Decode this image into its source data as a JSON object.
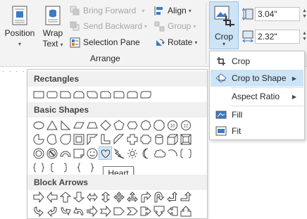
{
  "ribbon": {
    "position_label": "Position",
    "wrap_text_label_1": "Wrap",
    "wrap_text_label_2": "Text",
    "bring_forward_label": "Bring Forward",
    "send_backward_label": "Send Backward",
    "selection_pane_label": "Selection Pane",
    "align_label": "Align",
    "group_label": "Group",
    "rotate_label": "Rotate",
    "arrange_group_label": "Arrange",
    "crop_label": "Crop",
    "height_value": "3.04\"",
    "width_value": "2.32\""
  },
  "crop_menu": {
    "items": [
      {
        "label": "Crop",
        "icon": "crop-icon"
      },
      {
        "label": "Crop to Shape",
        "icon": "crop-to-shape-icon"
      },
      {
        "label": "Aspect Ratio",
        "icon": ""
      },
      {
        "label": "Fill",
        "icon": "fill-icon"
      },
      {
        "label": "Fit",
        "icon": "fit-icon"
      }
    ]
  },
  "shapes_panel": {
    "categories": [
      "Rectangles",
      "Basic Shapes",
      "Block Arrows"
    ],
    "tooltip": "Heart"
  },
  "colors": {
    "highlight": "#cde4f7",
    "highlight_border": "#9cc6e8",
    "ribbon_bg": "#f3f3f3",
    "header_bg": "#f0f0f0"
  }
}
